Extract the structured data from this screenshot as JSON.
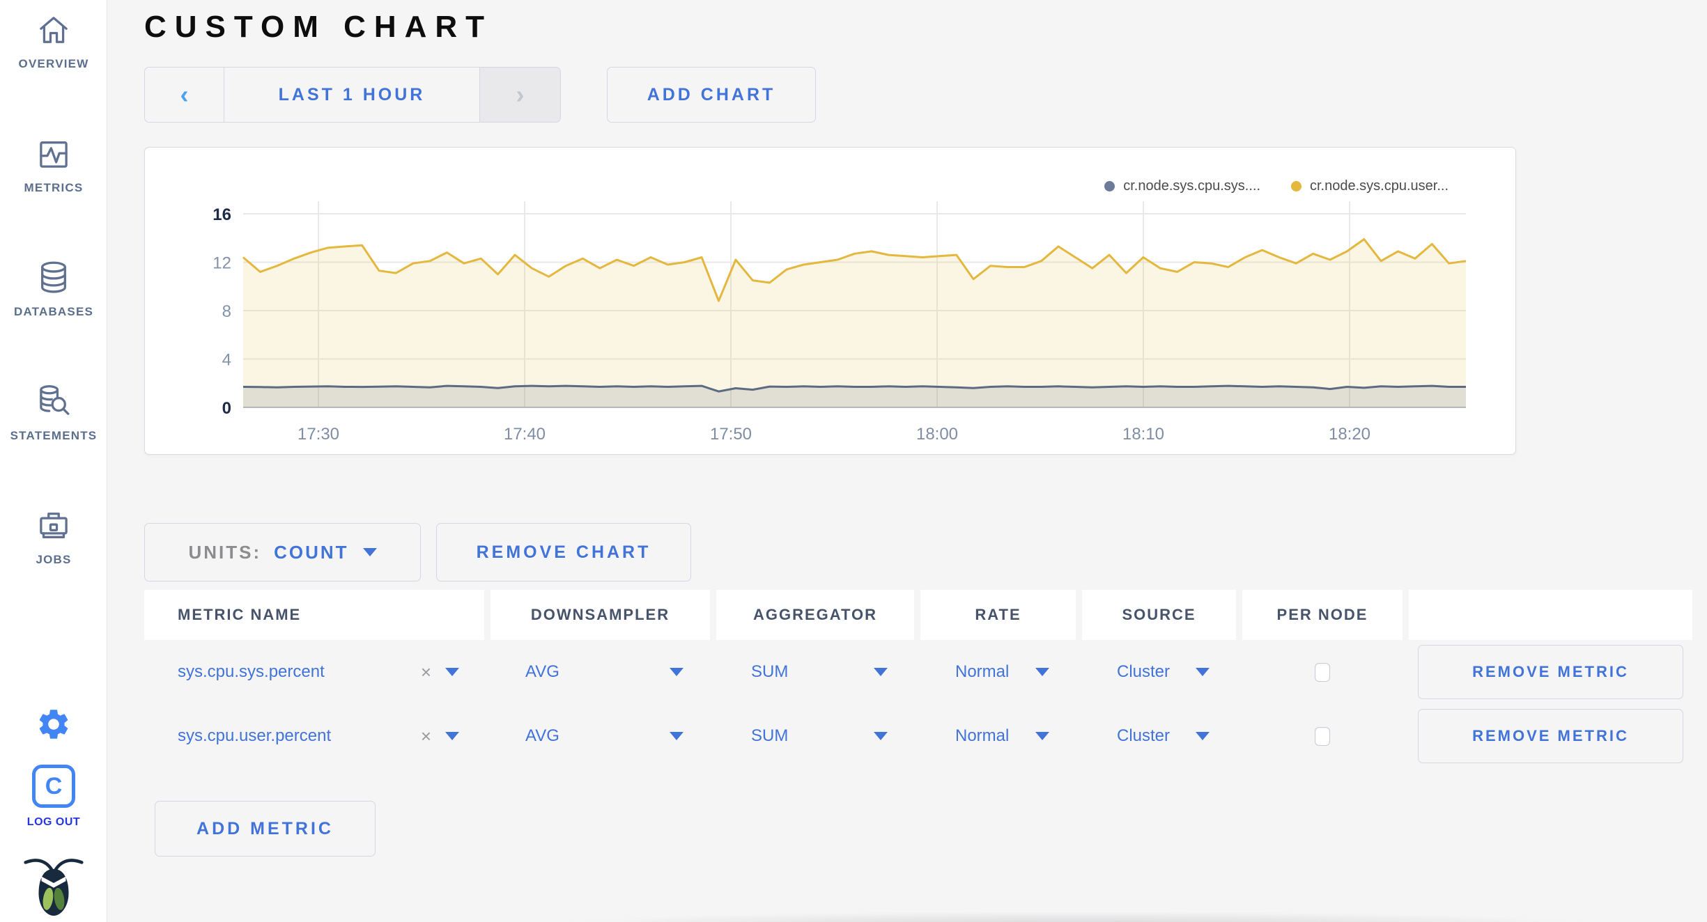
{
  "sidebar": {
    "items": [
      {
        "label": "OVERVIEW",
        "icon": "home-icon"
      },
      {
        "label": "METRICS",
        "icon": "metrics-icon"
      },
      {
        "label": "DATABASES",
        "icon": "database-icon"
      },
      {
        "label": "STATEMENTS",
        "icon": "statements-icon"
      },
      {
        "label": "JOBS",
        "icon": "jobs-icon"
      }
    ],
    "logout_initial": "C",
    "logout_label": "LOG OUT"
  },
  "header": {
    "title": "CUSTOM CHART"
  },
  "icons": {
    "prev": "‹",
    "next": "›",
    "clear": "×"
  },
  "time_selector": {
    "range_label": "LAST 1 HOUR"
  },
  "add_chart_label": "ADD CHART",
  "chart_data": {
    "type": "line",
    "title": "",
    "xlabel": "",
    "ylabel": "",
    "ylim": [
      0,
      16
    ],
    "y_ticks": [
      0,
      4,
      8,
      12,
      16
    ],
    "x_ticks": [
      "17:30",
      "17:40",
      "17:50",
      "18:00",
      "18:10",
      "18:20"
    ],
    "grid": true,
    "legend_position": "top-right",
    "legend": [
      {
        "name": "cr.node.sys.cpu.sys....",
        "color": "#6c7b99"
      },
      {
        "name": "cr.node.sys.cpu.user...",
        "color": "#e4b73e"
      }
    ],
    "series": [
      {
        "name": "cr.node.sys.cpu.sys....",
        "color": "#5d6b82",
        "fill": "rgba(95,108,128,0.16)",
        "values": [
          1.7,
          1.68,
          1.66,
          1.7,
          1.72,
          1.74,
          1.7,
          1.69,
          1.71,
          1.74,
          1.7,
          1.66,
          1.78,
          1.74,
          1.7,
          1.6,
          1.74,
          1.78,
          1.74,
          1.78,
          1.74,
          1.7,
          1.74,
          1.7,
          1.74,
          1.7,
          1.74,
          1.78,
          1.32,
          1.58,
          1.46,
          1.72,
          1.7,
          1.74,
          1.7,
          1.74,
          1.7,
          1.7,
          1.74,
          1.7,
          1.74,
          1.7,
          1.66,
          1.6,
          1.7,
          1.74,
          1.7,
          1.7,
          1.74,
          1.7,
          1.66,
          1.7,
          1.74,
          1.7,
          1.74,
          1.7,
          1.7,
          1.74,
          1.78,
          1.74,
          1.7,
          1.74,
          1.7,
          1.66,
          1.52,
          1.7,
          1.62,
          1.74,
          1.7,
          1.74,
          1.78,
          1.7,
          1.7
        ]
      },
      {
        "name": "cr.node.sys.cpu.user...",
        "color": "#e4b73e",
        "fill": "rgba(228,183,62,0.14)",
        "values": [
          12.4,
          11.2,
          11.7,
          12.3,
          12.8,
          13.2,
          13.3,
          13.4,
          11.3,
          11.1,
          11.9,
          12.1,
          12.8,
          11.9,
          12.3,
          11.0,
          12.6,
          11.5,
          10.8,
          11.7,
          12.3,
          11.5,
          12.2,
          11.7,
          12.4,
          11.8,
          12.0,
          12.4,
          8.8,
          12.2,
          10.5,
          10.3,
          11.4,
          11.8,
          12.0,
          12.2,
          12.7,
          12.9,
          12.6,
          12.5,
          12.4,
          12.5,
          12.6,
          10.6,
          11.7,
          11.6,
          11.6,
          12.1,
          13.3,
          12.4,
          11.5,
          12.6,
          11.1,
          12.4,
          11.5,
          11.2,
          12.0,
          11.9,
          11.6,
          12.4,
          13.0,
          12.4,
          11.9,
          12.7,
          12.2,
          12.9,
          13.9,
          12.1,
          12.9,
          12.3,
          13.5,
          11.9,
          12.1
        ]
      }
    ]
  },
  "units_control": {
    "label": "UNITS:",
    "value": "COUNT"
  },
  "remove_chart_label": "REMOVE CHART",
  "metrics_table": {
    "columns": [
      "METRIC NAME",
      "DOWNSAMPLER",
      "AGGREGATOR",
      "RATE",
      "SOURCE",
      "PER NODE",
      ""
    ],
    "rows": [
      {
        "metric_name": "sys.cpu.sys.percent",
        "downsampler": "AVG",
        "aggregator": "SUM",
        "rate": "Normal",
        "source": "Cluster",
        "per_node": false,
        "remove_label": "REMOVE METRIC"
      },
      {
        "metric_name": "sys.cpu.user.percent",
        "downsampler": "AVG",
        "aggregator": "SUM",
        "rate": "Normal",
        "source": "Cluster",
        "per_node": false,
        "remove_label": "REMOVE METRIC"
      }
    ]
  },
  "add_metric_label": "ADD METRIC"
}
